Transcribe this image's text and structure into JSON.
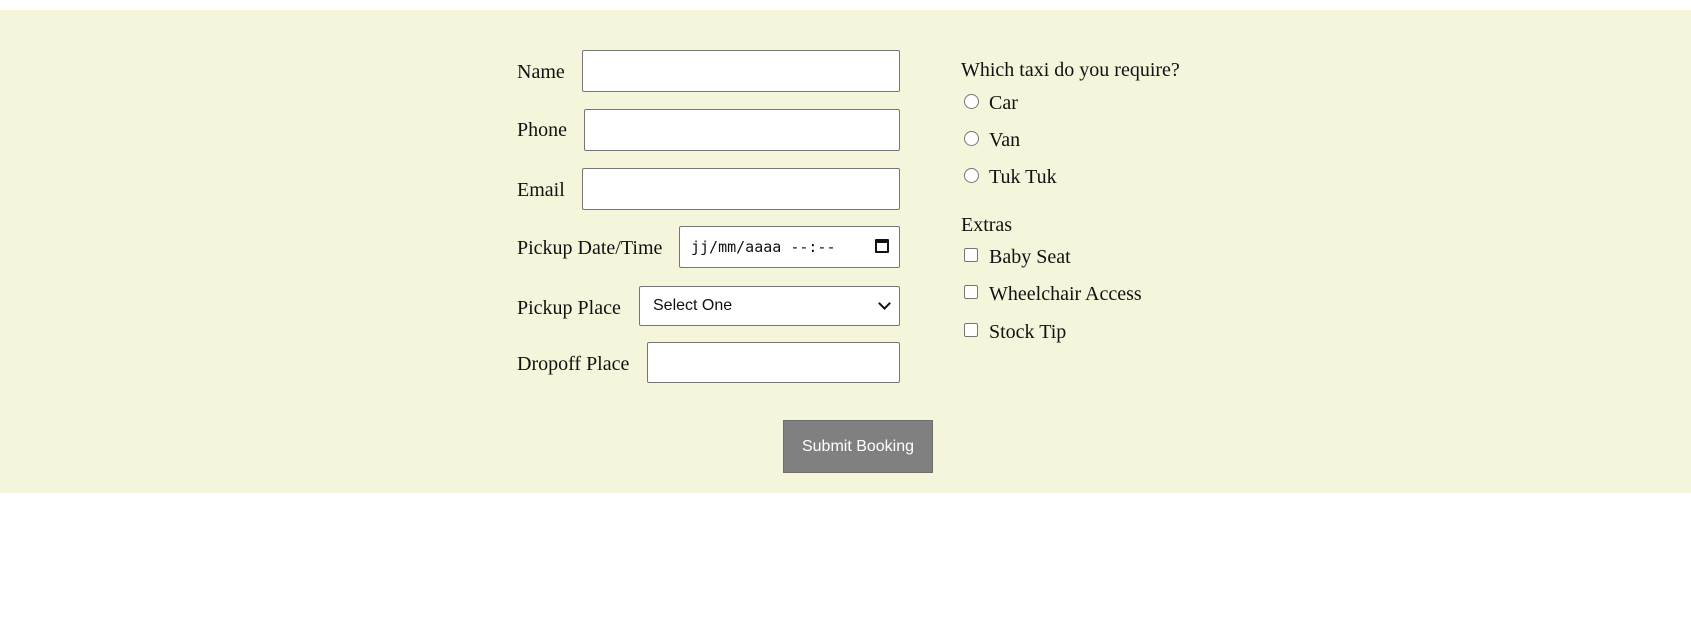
{
  "form": {
    "name_label": "Name",
    "name_value": "",
    "phone_label": "Phone",
    "phone_value": "",
    "email_label": "Email",
    "email_value": "",
    "pickup_datetime_label": "Pickup Date/Time",
    "pickup_datetime_placeholder": "jj/mm/aaaa --:--",
    "pickup_place_label": "Pickup Place",
    "pickup_place_selected": "Select One",
    "dropoff_place_label": "Dropoff Place",
    "dropoff_place_value": ""
  },
  "taxi": {
    "question": "Which taxi do you require?",
    "options": [
      "Car",
      "Van",
      "Tuk Tuk"
    ]
  },
  "extras": {
    "title": "Extras",
    "options": [
      "Baby Seat",
      "Wheelchair Access",
      "Stock Tip"
    ]
  },
  "submit_label": "Submit Booking",
  "colors": {
    "panel_background": "#f5f5dc",
    "button_background": "#808080",
    "button_text": "#ffffff"
  },
  "icons": {
    "datetime": "calendar-icon",
    "select": "chevron-down-icon"
  }
}
